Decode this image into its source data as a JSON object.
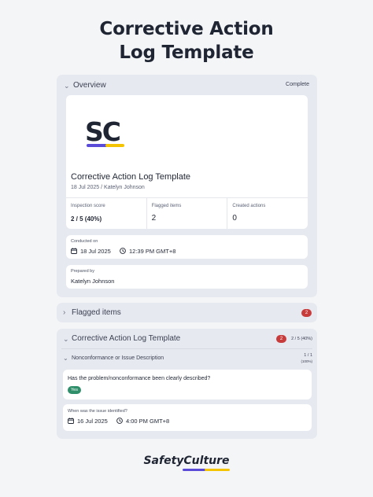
{
  "page": {
    "title_line1": "Corrective Action",
    "title_line2": "Log Template"
  },
  "overview": {
    "heading": "Overview",
    "status": "Complete",
    "logo_text": "SC",
    "report_title": "Corrective Action Log Template",
    "report_subtitle": "18 Jul 2025 / Katelyn Johnson",
    "stats": [
      {
        "label": "Inspection score",
        "value": "2 / 5 (40%)"
      },
      {
        "label": "Flagged items",
        "value": "2"
      },
      {
        "label": "Created actions",
        "value": "0"
      }
    ],
    "conducted": {
      "label": "Conducted on",
      "date": "18 Jul 2025",
      "time": "12:39 PM GMT+8"
    },
    "prepared": {
      "label": "Prepared by",
      "value": "Katelyn Johnson"
    }
  },
  "flagged": {
    "heading": "Flagged items",
    "count": "2"
  },
  "log_section": {
    "heading": "Corrective Action Log Template",
    "flag_count": "2",
    "score": "2 / 5 (40%)",
    "subsection": {
      "heading": "Nonconformance or Issue Description",
      "progress": "1 / 1",
      "progress_pct": "(100%)"
    },
    "question1": {
      "text": "Has the problem/nonconformance been clearly described?",
      "answer": "Yes"
    },
    "question2": {
      "label": "When was the issue identified?",
      "date": "16 Jul 2025",
      "time": "4:00 PM GMT+8"
    }
  },
  "footer": {
    "brand_part1": "Safety",
    "brand_part2": "Culture"
  },
  "colors": {
    "brand_purple": "#5a4bd8",
    "brand_yellow": "#f5c400",
    "flag_red": "#c83b3b",
    "yes_green": "#2f8f6b"
  },
  "icons": [
    "chevron-down-icon",
    "chevron-right-icon",
    "calendar-icon",
    "clock-icon"
  ]
}
